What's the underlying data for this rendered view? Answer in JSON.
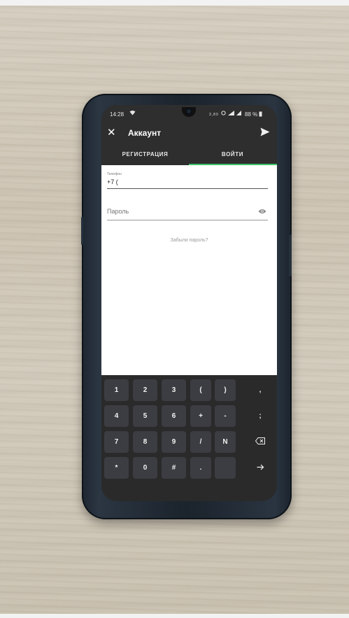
{
  "status_bar": {
    "time": "14:28",
    "network_label": "3,80",
    "battery": "88 %"
  },
  "toolbar": {
    "title": "Аккаунт"
  },
  "tabs": [
    {
      "label": "РЕГИСТРАЦИЯ"
    },
    {
      "label": "ВОЙТИ"
    }
  ],
  "form": {
    "phone_label": "Телефон",
    "phone_value": "+7 (",
    "password_placeholder": "Пароль",
    "forgot_link": "Забыли пароль?"
  },
  "keyboard": {
    "keys": [
      [
        "1",
        "2",
        "3",
        "(",
        ")",
        ","
      ],
      [
        "4",
        "5",
        "6",
        "+",
        "-",
        ";"
      ],
      [
        "7",
        "8",
        "9",
        "/",
        "N",
        ""
      ],
      [
        "*",
        "0",
        "#",
        ".",
        "",
        ""
      ]
    ]
  },
  "colors": {
    "accent": "#3ec46d",
    "app_bar": "#2e2e2e",
    "key_bg": "#3b3d42"
  },
  "icons": {
    "close": "close-icon",
    "send": "send-icon",
    "visibility": "eye-icon",
    "backspace": "backspace-icon",
    "next": "arrow-right-icon"
  }
}
